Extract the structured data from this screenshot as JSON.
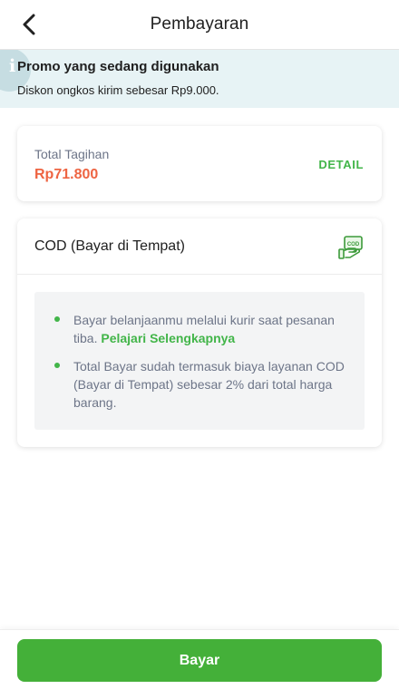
{
  "header": {
    "title": "Pembayaran",
    "back_icon": "chevron-left-icon"
  },
  "promo": {
    "icon": "info-icon",
    "icon_glyph": "i",
    "title": "Promo yang sedang digunakan",
    "description": "Diskon ongkos kirim sebesar Rp9.000."
  },
  "total": {
    "label": "Total Tagihan",
    "value": "Rp71.800",
    "detail_label": "DETAIL"
  },
  "cod": {
    "title": "COD (Bayar di Tempat)",
    "icon": "cod-cash-icon",
    "icon_text": "COD",
    "bullets": [
      {
        "text": "Bayar belanjaanmu melalui kurir saat pesanan tiba. ",
        "link": "Pelajari Selengkapnya"
      },
      {
        "text": "Total Bayar sudah termasuk biaya layanan COD (Bayar di Tempat) sebesar 2% dari total harga barang."
      }
    ]
  },
  "footer": {
    "pay_label": "Bayar"
  },
  "colors": {
    "primary_green": "#42b549",
    "button_green": "#44b039",
    "price_orange": "#ee6442",
    "promo_bg": "#e7f3f5"
  }
}
